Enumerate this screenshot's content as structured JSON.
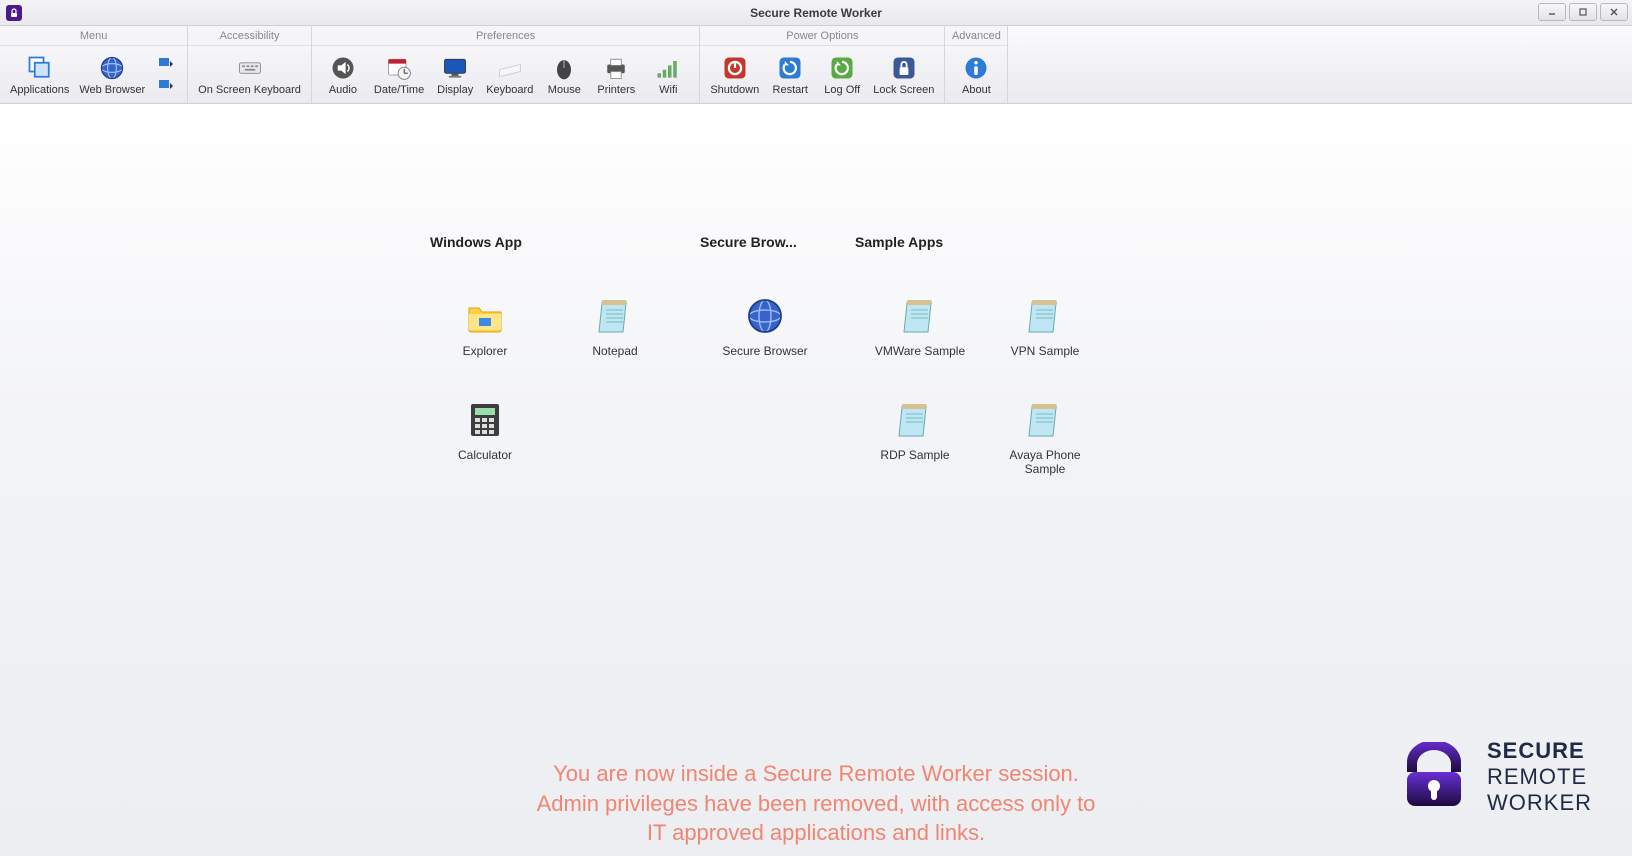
{
  "window": {
    "title": "Secure Remote Worker"
  },
  "ribbon": {
    "groups": {
      "menu": {
        "header": "Menu",
        "applications": "Applications",
        "web_browser": "Web Browser"
      },
      "accessibility": {
        "header": "Accessibility",
        "osk": "On Screen Keyboard"
      },
      "preferences": {
        "header": "Preferences",
        "audio": "Audio",
        "datetime": "Date/Time",
        "display": "Display",
        "keyboard": "Keyboard",
        "mouse": "Mouse",
        "printers": "Printers",
        "wifi": "Wifi"
      },
      "power": {
        "header": "Power Options",
        "shutdown": "Shutdown",
        "restart": "Restart",
        "logoff": "Log Off",
        "lock": "Lock Screen"
      },
      "advanced": {
        "header": "Advanced",
        "about": "About"
      }
    }
  },
  "desktop": {
    "categories": {
      "windows_app": "Windows App",
      "secure_browser": "Secure Brow...",
      "sample_apps": "Sample Apps"
    },
    "tiles": {
      "explorer": "Explorer",
      "notepad": "Notepad",
      "secure_browser": "Secure Browser",
      "vmware": "VMWare Sample",
      "vpn": "VPN Sample",
      "calculator": "Calculator",
      "rdp": "RDP Sample",
      "avaya": "Avaya Phone Sample"
    }
  },
  "footer": {
    "line1": "You are now inside a Secure Remote Worker session.",
    "line2": "Admin privileges have been removed, with access only to",
    "line3": "IT approved applications and links."
  },
  "brand": {
    "line1": "SECURE",
    "line2": "REMOTE",
    "line3": "WORKER"
  }
}
